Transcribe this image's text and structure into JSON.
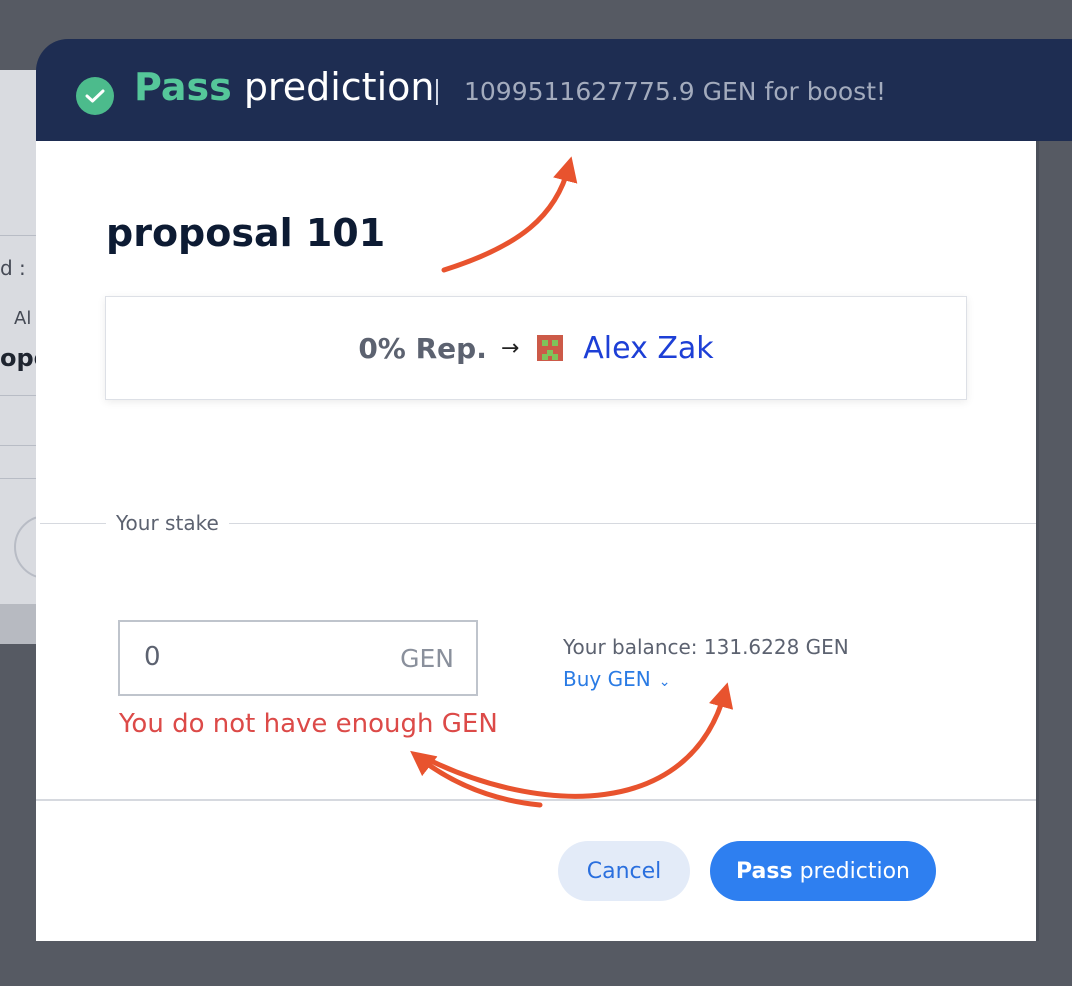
{
  "background": {
    "frag_text_a": "d :",
    "frag_text_b": "Al",
    "frag_text_c": "opo"
  },
  "header": {
    "title_pass": "Pass",
    "title_rest": "prediction",
    "separator": "|",
    "boost_text": "1099511627775.9 GEN for boost!",
    "icon": "check-circle-icon"
  },
  "proposal": {
    "title": "proposal 101"
  },
  "reputation": {
    "percent": "0% Rep.",
    "arrow": "→",
    "recipient": "Alex Zak",
    "avatar_icon": "pixel-avatar-icon"
  },
  "stake": {
    "section_label": "Your stake",
    "value": "0",
    "unit": "GEN",
    "error": "You do not have enough GEN"
  },
  "balance": {
    "text": "Your balance: 131.6228 GEN",
    "buy_label": "Buy GEN",
    "buy_icon": "chevron-down-icon"
  },
  "actions": {
    "cancel_label": "Cancel",
    "pass_bold": "Pass",
    "pass_rest": "prediction"
  },
  "colors": {
    "header_bg": "#1e2d52",
    "pass_green": "#55c79a",
    "error_red": "#dc4a48",
    "primary_blue": "#2e7ff0",
    "annotation_orange": "#e8532e"
  }
}
